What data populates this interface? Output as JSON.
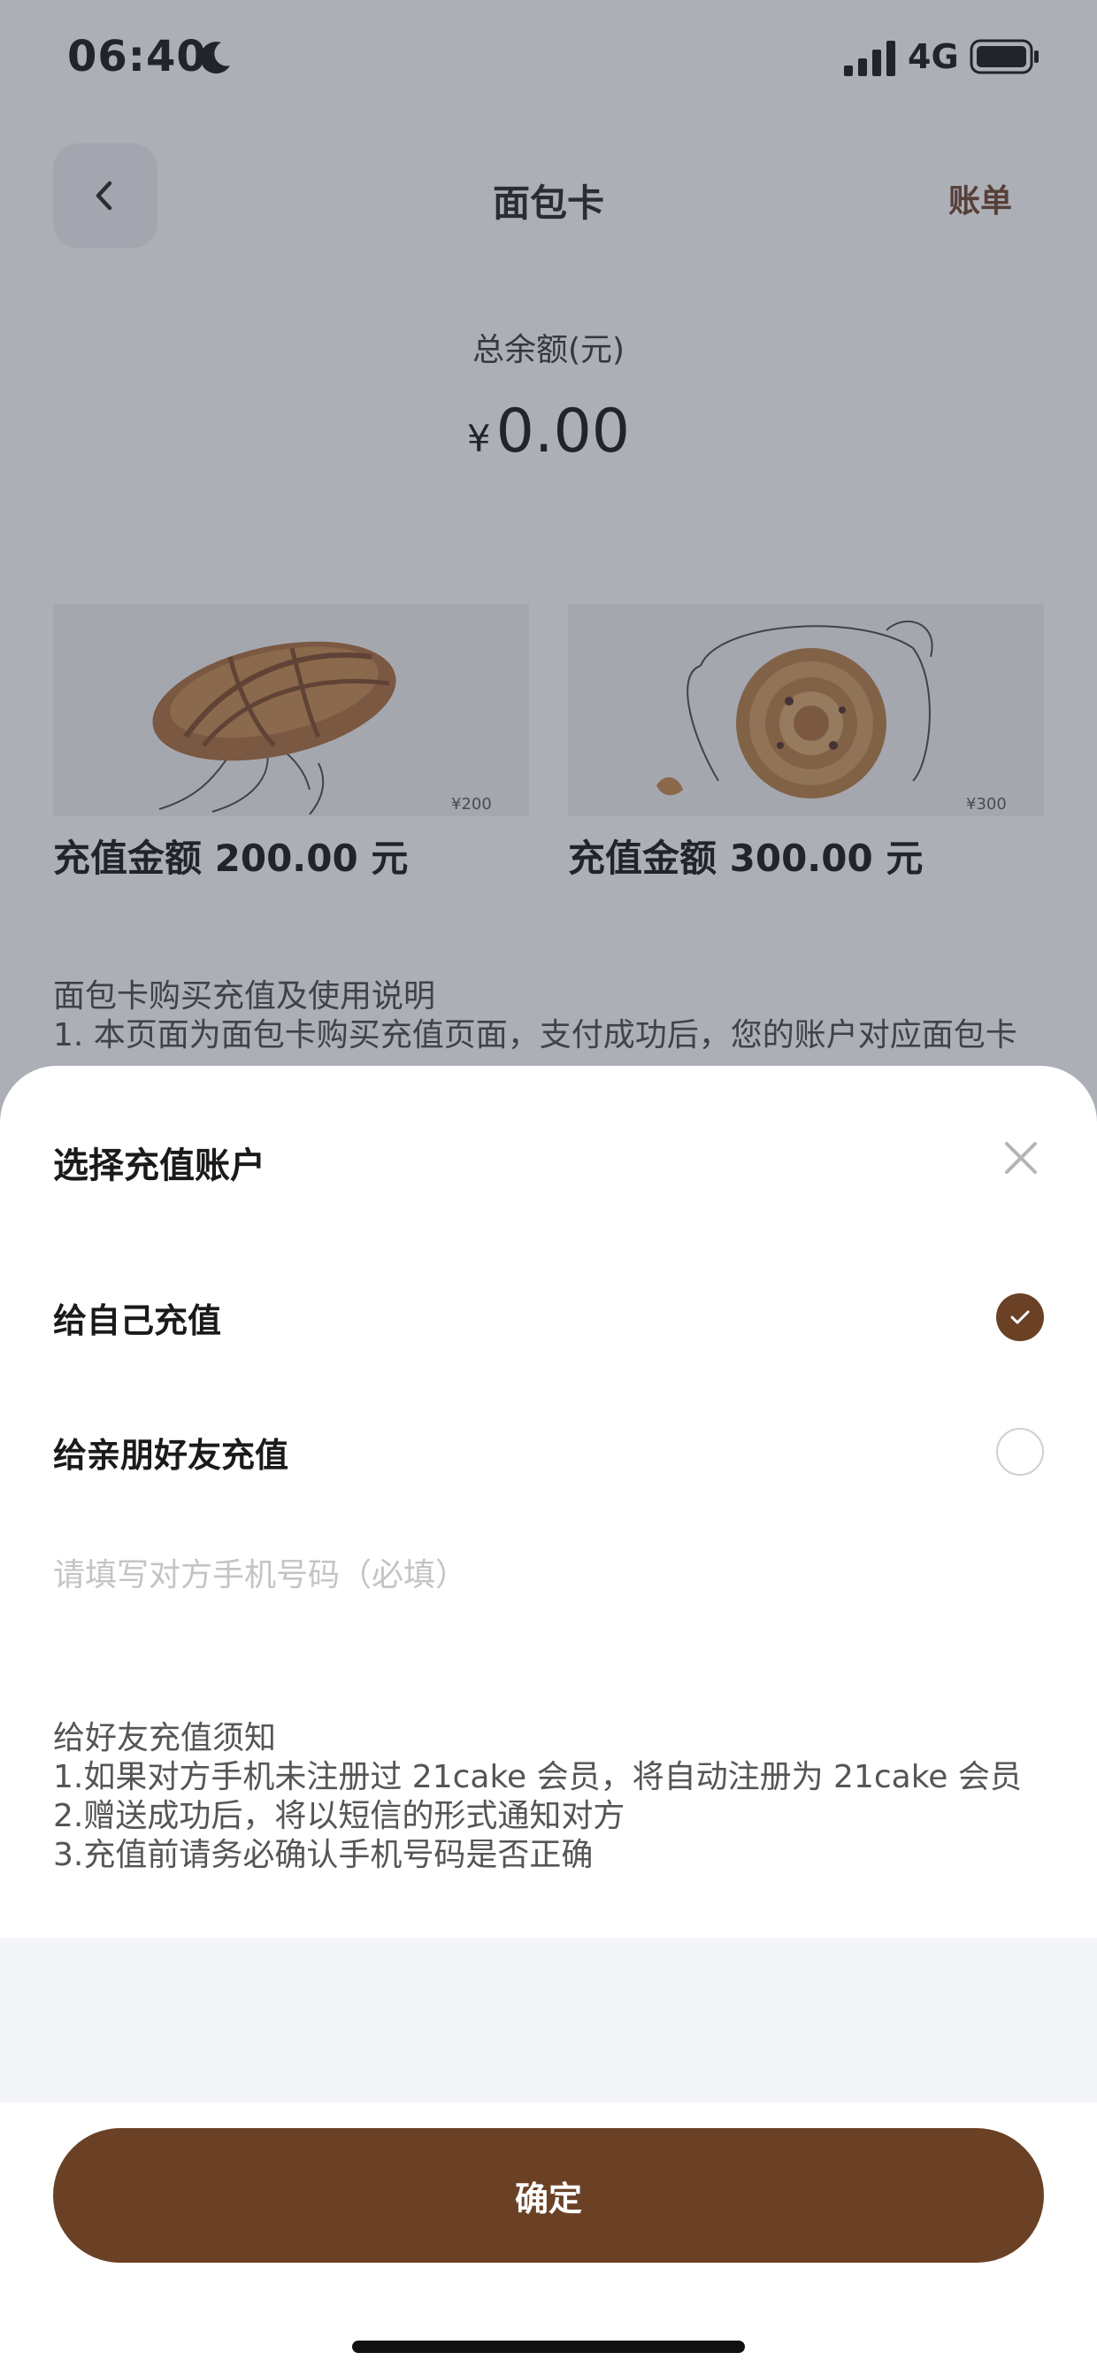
{
  "status_bar": {
    "time": "06:40",
    "network": "4G",
    "icons": [
      "moon-icon",
      "signal-icon",
      "battery-icon"
    ]
  },
  "header": {
    "title": "面包卡",
    "right_link": "账单",
    "back_icon": "chevron-left-icon"
  },
  "balance": {
    "label": "总余额(元)",
    "currency": "¥",
    "amount": "0.00"
  },
  "cards": [
    {
      "label": "充值金额 200.00 元",
      "image_price": "¥200"
    },
    {
      "label": "充值金额 300.00 元",
      "image_price": "¥300"
    }
  ],
  "notes": {
    "title": "面包卡购买充值及使用说明",
    "line1": "1. 本页面为面包卡购买充值页面，支付成功后，您的账户对应面包卡"
  },
  "sheet": {
    "title": "选择充值账户",
    "options": [
      {
        "label": "给自己充值",
        "selected": true
      },
      {
        "label": "给亲朋好友充值",
        "selected": false
      }
    ],
    "phone_placeholder": "请填写对方手机号码（必填）",
    "phone_value": "",
    "notice": {
      "title": "给好友充值须知",
      "lines": [
        "1.如果对方手机未注册过 21cake 会员，将自动注册为 21cake 会员",
        "2.赠送成功后，将以短信的形式通知对方",
        "3.充值前请务必确认手机号码是否正确"
      ]
    },
    "confirm_label": "确定"
  },
  "colors": {
    "accent": "#6b4126",
    "overlay": "#3c4054",
    "band": "#f4f5f8"
  }
}
